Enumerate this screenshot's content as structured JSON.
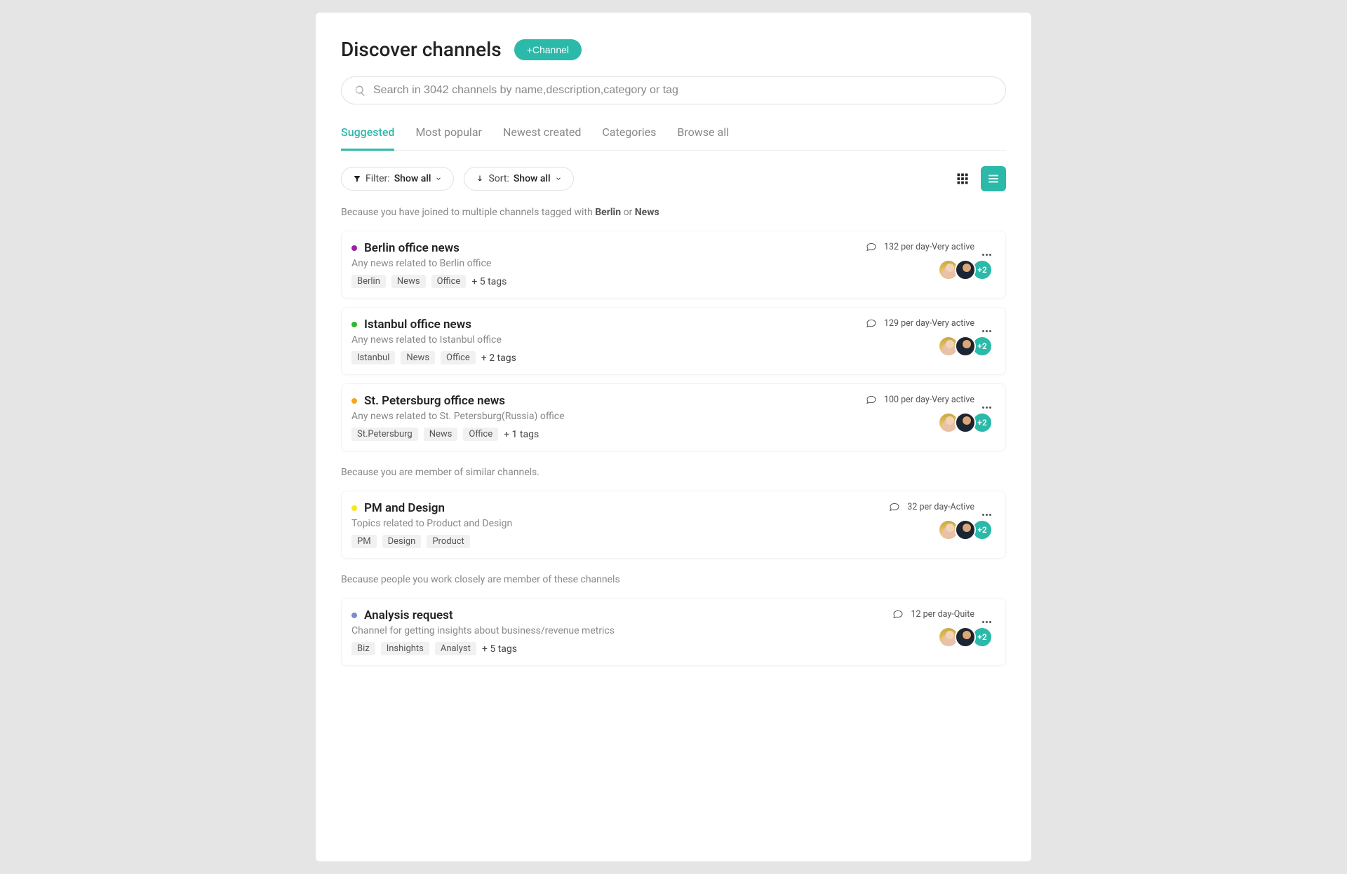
{
  "header": {
    "title": "Discover channels",
    "add_button": "+Channel"
  },
  "search": {
    "placeholder": "Search in 3042 channels by name,description,category or tag"
  },
  "tabs": [
    "Suggested",
    "Most popular",
    "Newest created",
    "Categories",
    "Browse all"
  ],
  "active_tab_index": 0,
  "filter": {
    "filter_label": "Filter:",
    "filter_value": "Show all",
    "sort_label": "Sort:",
    "sort_value": "Show all"
  },
  "colors": {
    "accent": "#2bb9a9"
  },
  "sections": [
    {
      "reason_prefix": "Because you have joined to multiple channels tagged with ",
      "reason_terms": [
        "Berlin",
        "News"
      ],
      "reason_joiner": " or ",
      "channels": [
        {
          "dot": "#9b1fa3",
          "title": "Berlin office news",
          "desc": "Any news related to Berlin office",
          "tags": [
            "Berlin",
            "News",
            "Office"
          ],
          "more_tags": "+ 5 tags",
          "activity": "132 per day-Very active",
          "more_avatars": "+2"
        },
        {
          "dot": "#2eb82e",
          "title": "Istanbul office news",
          "desc": "Any news related to Istanbul office",
          "tags": [
            "Istanbul",
            "News",
            "Office"
          ],
          "more_tags": "+ 2 tags",
          "activity": "129 per day-Very active",
          "more_avatars": "+2"
        },
        {
          "dot": "#f5a623",
          "title": "St. Petersburg office news",
          "desc": "Any news related to St. Petersburg(Russia) office",
          "tags": [
            "St.Petersburg",
            "News",
            "Office"
          ],
          "more_tags": "+ 1 tags",
          "activity": "100 per day-Very active",
          "more_avatars": "+2"
        }
      ]
    },
    {
      "reason_plain": "Because you are member of similar channels.",
      "channels": [
        {
          "dot": "#f8e71c",
          "title": "PM and Design",
          "desc": "Topics related to Product and Design",
          "tags": [
            "PM",
            "Design",
            "Product"
          ],
          "more_tags": "",
          "activity": "32 per day-Active",
          "more_avatars": "+2"
        }
      ]
    },
    {
      "reason_plain": "Because people you work closely are member of these channels",
      "channels": [
        {
          "dot": "#7b8ec8",
          "title": "Analysis request",
          "desc": "Channel for getting insights about business/revenue metrics",
          "tags": [
            "Biz",
            "Inshights",
            "Analyst"
          ],
          "more_tags": "+ 5 tags",
          "activity": "12 per day-Quite",
          "more_avatars": "+2"
        }
      ]
    }
  ]
}
